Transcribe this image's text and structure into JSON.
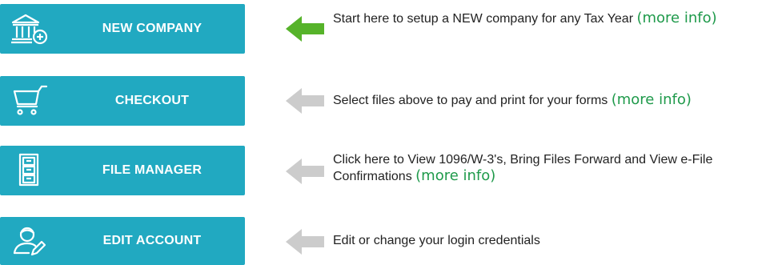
{
  "rows": [
    {
      "button_label": "NEW COMPANY",
      "icon": "bank-building-plus-icon",
      "arrow": "green-left-arrow",
      "desc_text": "Start here to setup a NEW company for any Tax Year ",
      "more_link": "(more info)"
    },
    {
      "button_label": "CHECKOUT",
      "icon": "shopping-cart-icon",
      "arrow": "gray-left-arrow",
      "desc_text": "Select files above to pay and print for your forms ",
      "more_link": "(more info)"
    },
    {
      "button_label": "FILE MANAGER",
      "icon": "file-cabinet-icon",
      "arrow": "gray-left-arrow",
      "desc_line1": "Click here to View 1096/W-3's, Bring Files Forward and View e-File",
      "desc_text": "Confirmations ",
      "more_link": "(more info)"
    },
    {
      "button_label": "EDIT ACCOUNT",
      "icon": "user-edit-icon",
      "arrow": "gray-left-arrow",
      "desc_text": "Edit or change your login credentials"
    }
  ],
  "colors": {
    "button_bg": "#21a9c1",
    "button_text": "#ffffff",
    "arrow_active": "#56b32a",
    "arrow_inactive": "#cccccc",
    "link": "#1f9a4b"
  }
}
